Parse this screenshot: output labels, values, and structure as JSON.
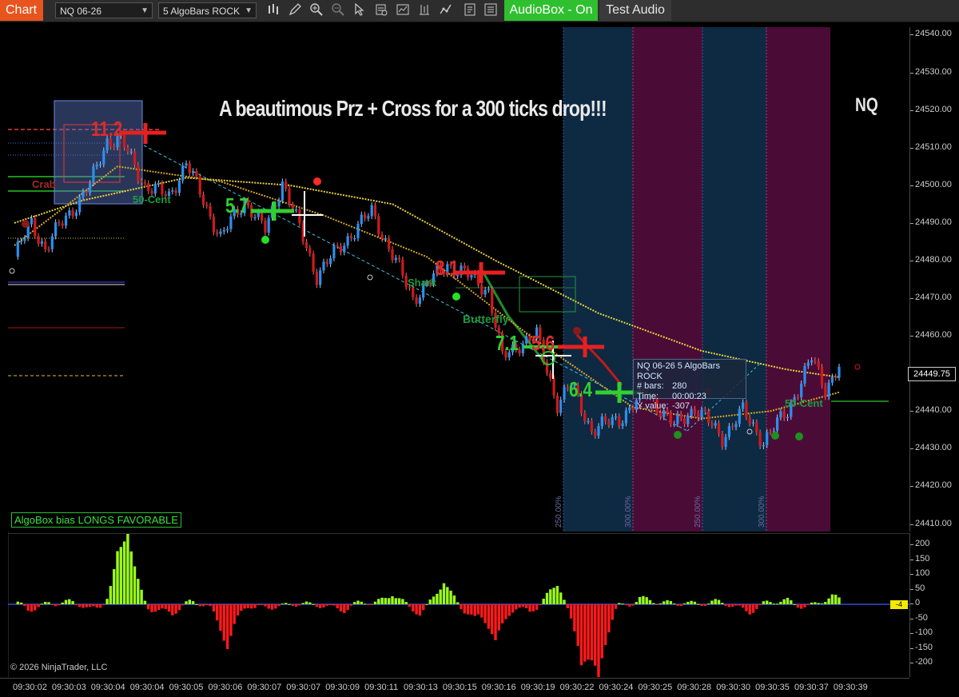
{
  "toolbar": {
    "chart_tab": "Chart",
    "instrument": "NQ 06-26",
    "bar_type": "5 AlgoBars ROCK",
    "audiobox_label": "AudioBox - On",
    "test_audio_label": "Test Audio",
    "icons": [
      "bar-style-icon",
      "draw-pencil-icon",
      "zoom-in-icon",
      "zoom-out-icon",
      "pointer-icon",
      "properties-icon",
      "indicators-icon",
      "strategies-icon",
      "templates-icon"
    ]
  },
  "chart": {
    "headline": "A beautimous Prz + Cross for a 300 ticks drop!!!",
    "symbol": "NQ",
    "bias": "AlgoBox bias LONGS FAVORABLE",
    "copyright": "© 2026 NinjaTrader, LLC",
    "last_price": "24449.75",
    "indicator_value": "-4",
    "markers": {
      "m1": "11.2",
      "m2": "5.7",
      "m3": "8.1",
      "m4": "7.1",
      "m5": "5.6",
      "m6": "6.4"
    },
    "labels": {
      "fifty_cent_1": "50-Cent",
      "fifty_cent_2": "50-Cent",
      "shark": "Shark",
      "butterfly": "Butterfly",
      "crab": "Crab"
    },
    "zone_pcts": [
      "250.00%",
      "300.00%",
      "250.00%",
      "300.00%"
    ],
    "tooltip": {
      "title": "NQ 06-26 5 AlgoBars ROCK",
      "bars_label": "# bars:",
      "bars_value": "280",
      "time_label": "Time:",
      "time_value": "00:00:23",
      "y_label": "Y value:",
      "y_value": "-307"
    },
    "colors": {
      "up": "#2b8ff0",
      "down": "#d11a1a",
      "green_marker": "#27c227",
      "red_marker": "#e83030",
      "ma_yellow": "#e9d33a",
      "zone_blue": "#0f2a44",
      "zone_magenta": "#4a0d36"
    }
  },
  "price_axis": [
    "24540.00",
    "24530.00",
    "24520.00",
    "24510.00",
    "24500.00",
    "24490.00",
    "24480.00",
    "24470.00",
    "24460.00",
    "24450.00",
    "24440.00",
    "24430.00",
    "24420.00",
    "24410.00"
  ],
  "indicator_axis": [
    "200",
    "150",
    "100",
    "50",
    "0",
    "-50",
    "-100",
    "-150",
    "-200"
  ],
  "time_axis": [
    "09:30:02",
    "09:30:03",
    "09:30:04",
    "09:30:04",
    "09:30:05",
    "09:30:06",
    "09:30:07",
    "09:30:07",
    "09:30:09",
    "09:30:11",
    "09:30:13",
    "09:30:15",
    "09:30:16",
    "09:30:19",
    "09:30:22",
    "09:30:24",
    "09:30:25",
    "09:30:28",
    "09:30:30",
    "09:30:35",
    "09:30:37",
    "09:30:39"
  ],
  "chart_data": {
    "type": "line",
    "title": "",
    "xlabel": "",
    "ylabel": "",
    "ylim": [
      24408,
      24542
    ],
    "price_path_anchors": [
      {
        "i": 0,
        "y": 24481
      },
      {
        "i": 5,
        "y": 24490
      },
      {
        "i": 9,
        "y": 24483
      },
      {
        "i": 13,
        "y": 24489
      },
      {
        "i": 18,
        "y": 24495
      },
      {
        "i": 22,
        "y": 24500
      },
      {
        "i": 27,
        "y": 24512
      },
      {
        "i": 31,
        "y": 24512
      },
      {
        "i": 38,
        "y": 24500
      },
      {
        "i": 45,
        "y": 24497
      },
      {
        "i": 50,
        "y": 24506
      },
      {
        "i": 60,
        "y": 24486
      },
      {
        "i": 67,
        "y": 24496
      },
      {
        "i": 73,
        "y": 24488
      },
      {
        "i": 78,
        "y": 24501
      },
      {
        "i": 88,
        "y": 24476
      },
      {
        "i": 96,
        "y": 24485
      },
      {
        "i": 104,
        "y": 24493
      },
      {
        "i": 116,
        "y": 24470
      },
      {
        "i": 126,
        "y": 24479
      },
      {
        "i": 132,
        "y": 24476
      },
      {
        "i": 138,
        "y": 24472
      },
      {
        "i": 142,
        "y": 24454
      },
      {
        "i": 147,
        "y": 24458
      },
      {
        "i": 152,
        "y": 24460
      },
      {
        "i": 158,
        "y": 24442
      },
      {
        "i": 162,
        "y": 24447
      },
      {
        "i": 168,
        "y": 24435
      },
      {
        "i": 176,
        "y": 24438
      },
      {
        "i": 184,
        "y": 24445
      },
      {
        "i": 192,
        "y": 24436
      },
      {
        "i": 198,
        "y": 24441
      },
      {
        "i": 206,
        "y": 24433
      },
      {
        "i": 212,
        "y": 24440
      },
      {
        "i": 218,
        "y": 24432
      },
      {
        "i": 225,
        "y": 24440
      },
      {
        "i": 232,
        "y": 24454
      },
      {
        "i": 236,
        "y": 24446
      },
      {
        "i": 240,
        "y": 24452
      }
    ],
    "ma_fast_anchors": [
      [
        0,
        24484
      ],
      [
        30,
        24505
      ],
      [
        60,
        24501
      ],
      [
        90,
        24492
      ],
      [
        120,
        24481
      ],
      [
        150,
        24460
      ],
      [
        180,
        24441
      ],
      [
        200,
        24438
      ],
      [
        220,
        24440
      ],
      [
        240,
        24445
      ]
    ],
    "ma_slow_anchors": [
      [
        0,
        24490
      ],
      [
        20,
        24496
      ],
      [
        50,
        24502
      ],
      [
        80,
        24500
      ],
      [
        110,
        24495
      ],
      [
        140,
        24480
      ],
      [
        170,
        24466
      ],
      [
        200,
        24456
      ],
      [
        225,
        24451
      ],
      [
        240,
        24449
      ]
    ],
    "indicator_bars": [
      {
        "i": 4,
        "v": -18
      },
      {
        "i": 10,
        "v": 10
      },
      {
        "i": 22,
        "v": -15
      },
      {
        "i": 30,
        "v": 95
      },
      {
        "i": 33,
        "v": 210
      },
      {
        "i": 40,
        "v": -12
      },
      {
        "i": 46,
        "v": -30
      },
      {
        "i": 62,
        "v": -140
      },
      {
        "i": 70,
        "v": -20
      },
      {
        "i": 86,
        "v": -10
      },
      {
        "i": 96,
        "v": -15
      },
      {
        "i": 110,
        "v": 45
      },
      {
        "i": 118,
        "v": -40
      },
      {
        "i": 125,
        "v": 82
      },
      {
        "i": 134,
        "v": -55
      },
      {
        "i": 140,
        "v": -125
      },
      {
        "i": 150,
        "v": -30
      },
      {
        "i": 158,
        "v": 72
      },
      {
        "i": 165,
        "v": -180
      },
      {
        "i": 170,
        "v": -250
      },
      {
        "i": 182,
        "v": 22
      },
      {
        "i": 195,
        "v": 15
      },
      {
        "i": 214,
        "v": -20
      },
      {
        "i": 225,
        "v": 12
      },
      {
        "i": 238,
        "v": 20
      }
    ]
  }
}
